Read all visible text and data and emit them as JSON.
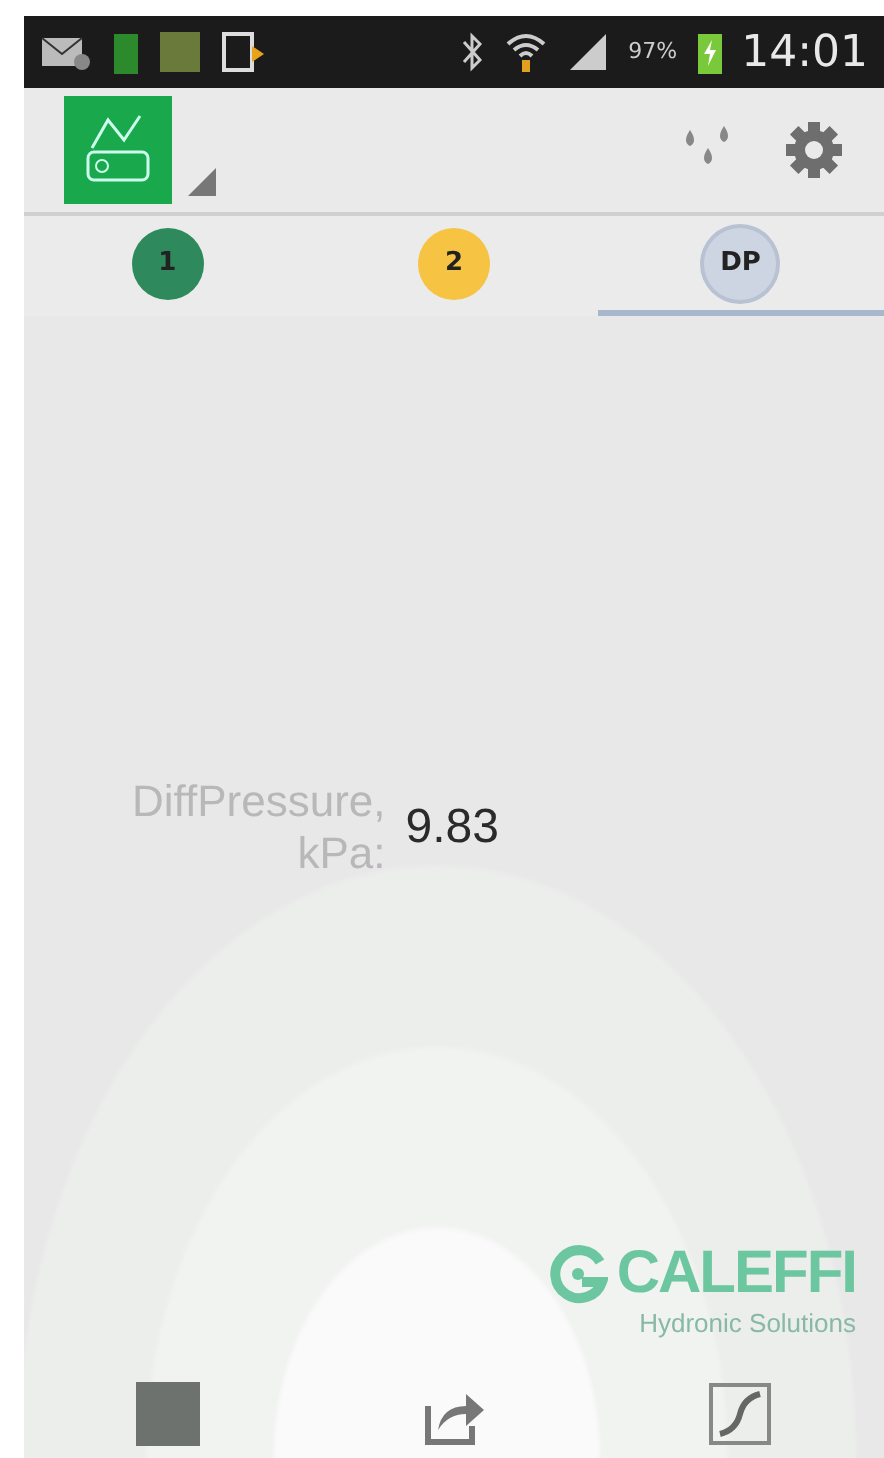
{
  "status_bar": {
    "battery": "97%",
    "time": "14:01"
  },
  "tabs": [
    {
      "label": "1",
      "color": "#2e8a5c",
      "selected": false
    },
    {
      "label": "2",
      "color": "#f6c343",
      "selected": false
    },
    {
      "label": "DP",
      "color": "#cdd5e2",
      "selected": true
    }
  ],
  "reading": {
    "label_lines": [
      "DiffPressure,",
      "kPa:"
    ],
    "value": "9.83"
  },
  "logo": {
    "name": "CALEFFI",
    "tagline": "Hydronic Solutions"
  }
}
